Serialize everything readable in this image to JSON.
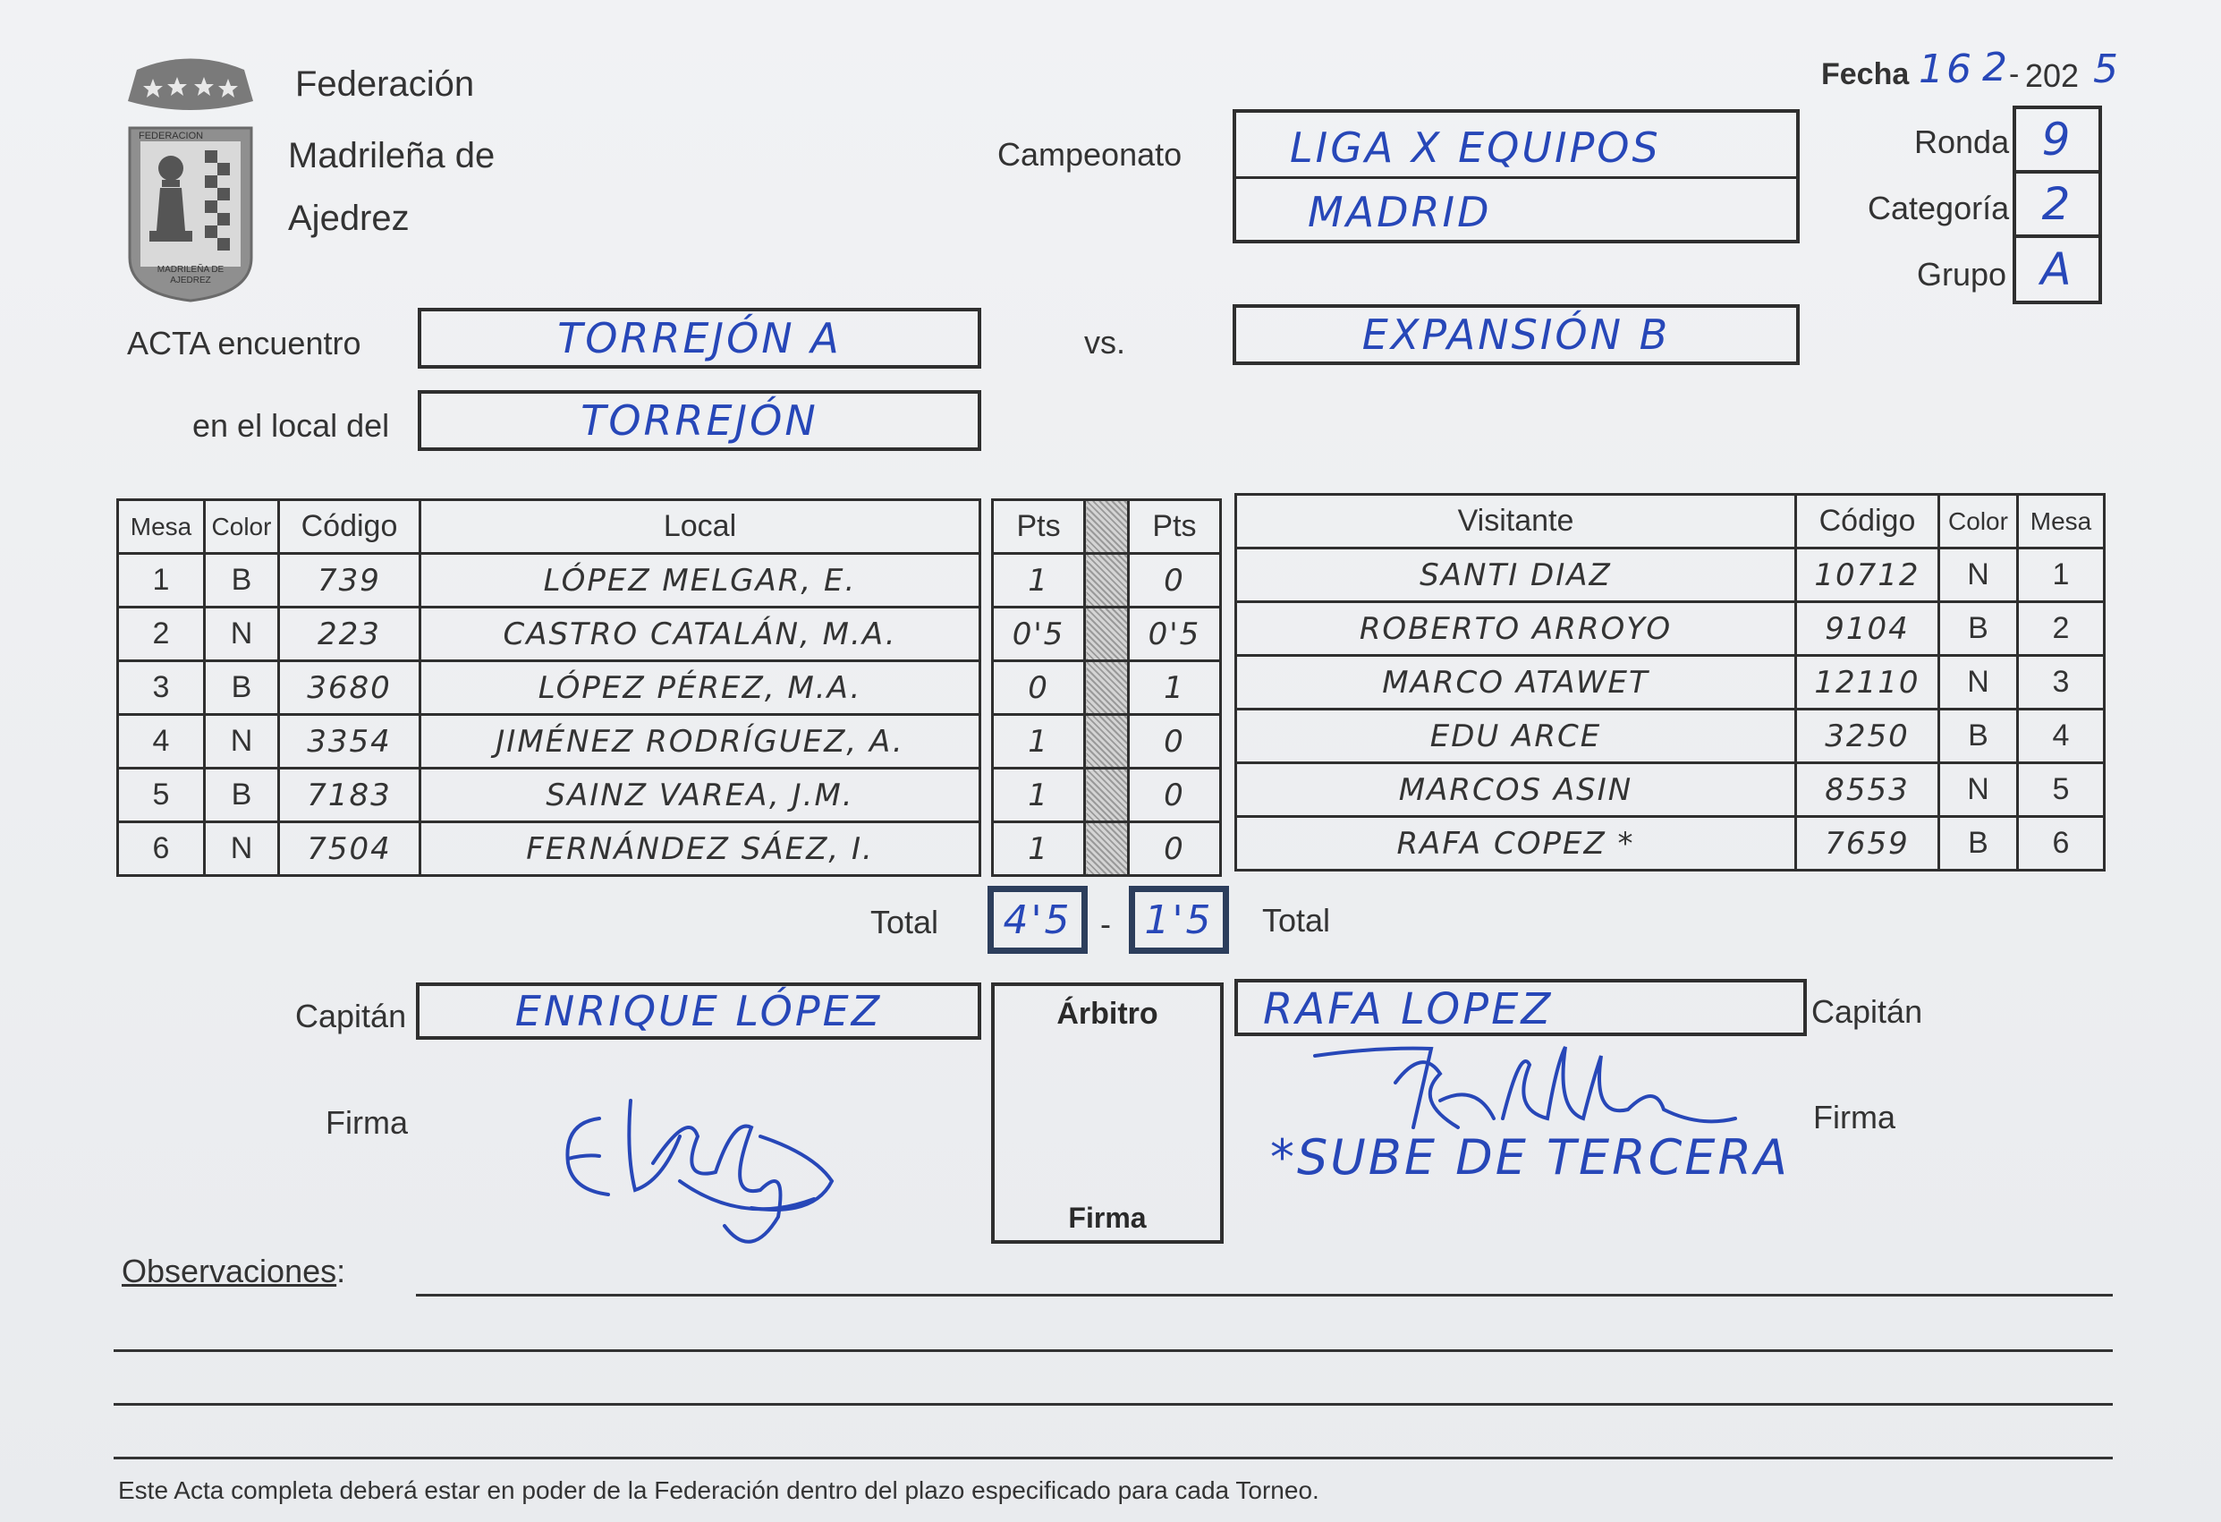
{
  "header": {
    "org_line1": "Federación",
    "org_line2": "Madrileña de",
    "org_line3": "Ajedrez",
    "logo_text_top": "FEDERACION",
    "logo_text_bottom": "MADRILEÑA DE AJEDREZ"
  },
  "labels": {
    "fecha": "Fecha",
    "campeonato": "Campeonato",
    "ronda": "Ronda",
    "categoria": "Categoría",
    "grupo": "Grupo",
    "acta": "ACTA encuentro",
    "vs": "vs.",
    "local_del": "en el local del",
    "total_left": "Total",
    "total_right": "Total",
    "dash": "-",
    "capitan_left": "Capitán",
    "capitan_right": "Capitán",
    "arbitro": "Árbitro",
    "firma_arbitro": "Firma",
    "firma_left": "Firma",
    "firma_right": "Firma",
    "observaciones": "Observaciones",
    "observaciones_colon": ":",
    "footer": "Este Acta completa deberá estar en poder de la Federación dentro del plazo especificado para cada Torneo."
  },
  "values": {
    "fecha_day": "16",
    "fecha_month": "2",
    "fecha_sep": "-",
    "fecha_year_prefix": "202",
    "fecha_year_digit": "5",
    "campeonato_line1": "LIGA X EQUIPOS",
    "campeonato_line2": "MADRID",
    "ronda": "9",
    "categoria": "2",
    "grupo": "A",
    "local_team": "TORREJÓN A",
    "visitor_team": "EXPANSIÓN B",
    "venue": "TORREJÓN",
    "total_local": "4'5",
    "total_visitor": "1'5",
    "captain_local": "ENRIQUE LÓPEZ",
    "captain_visitor": "RAFA LOPEZ",
    "note_visitor": "*SUBE DE TERCERA"
  },
  "table": {
    "headers": {
      "mesa": "Mesa",
      "color": "Color",
      "codigo": "Código",
      "local": "Local",
      "pts": "Pts",
      "visitante": "Visitante"
    },
    "rows": [
      {
        "mesa": "1",
        "color": "B",
        "codigo": "739",
        "local": "LÓPEZ MELGAR, E.",
        "pts_local": "1",
        "pts_visitor": "0",
        "visitante": "SANTI DIAZ",
        "codigo_v": "10712",
        "color_v": "N",
        "mesa_v": "1"
      },
      {
        "mesa": "2",
        "color": "N",
        "codigo": "223",
        "local": "CASTRO CATALÁN, M.A.",
        "pts_local": "0'5",
        "pts_visitor": "0'5",
        "visitante": "ROBERTO ARROYO",
        "codigo_v": "9104",
        "color_v": "B",
        "mesa_v": "2"
      },
      {
        "mesa": "3",
        "color": "B",
        "codigo": "3680",
        "local": "LÓPEZ PÉREZ, M.A.",
        "pts_local": "0",
        "pts_visitor": "1",
        "visitante": "MARCO ATAWET",
        "codigo_v": "12110",
        "color_v": "N",
        "mesa_v": "3"
      },
      {
        "mesa": "4",
        "color": "N",
        "codigo": "3354",
        "local": "JIMÉNEZ RODRÍGUEZ, A.",
        "pts_local": "1",
        "pts_visitor": "0",
        "visitante": "EDU ARCE",
        "codigo_v": "3250",
        "color_v": "B",
        "mesa_v": "4"
      },
      {
        "mesa": "5",
        "color": "B",
        "codigo": "7183",
        "local": "SAINZ VAREA, J.M.",
        "pts_local": "1",
        "pts_visitor": "0",
        "visitante": "MARCOS ASIN",
        "codigo_v": "8553",
        "color_v": "N",
        "mesa_v": "5"
      },
      {
        "mesa": "6",
        "color": "N",
        "codigo": "7504",
        "local": "FERNÁNDEZ SÁEZ, I.",
        "pts_local": "1",
        "pts_visitor": "0",
        "visitante": "RAFA COPEZ *",
        "codigo_v": "7659",
        "color_v": "B",
        "mesa_v": "6"
      }
    ]
  },
  "colors": {
    "ink_blue": "#2747b8",
    "print_black": "#2f2f2f",
    "total_box": "#2c3e5c"
  }
}
